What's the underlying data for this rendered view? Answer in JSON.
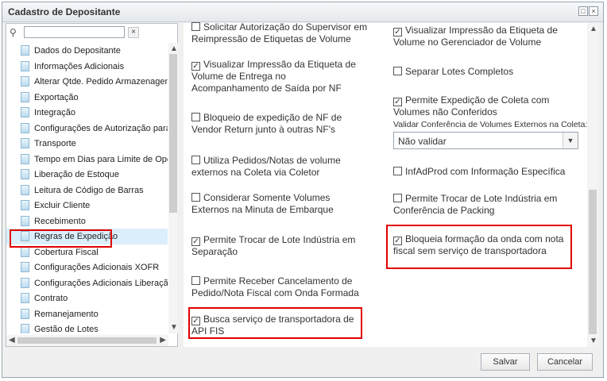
{
  "window": {
    "title": "Cadastro de Depositante",
    "controls": [
      "□",
      "×"
    ]
  },
  "filter": {
    "value": "",
    "clear_label": "×"
  },
  "tree": {
    "items": [
      "Dados do Depositante",
      "Informações Adicionais",
      "Alterar Qtde. Pedido Armazenagem",
      "Exportação",
      "Integração",
      "Configurações de Autorização para B",
      "Transporte",
      "Tempo em Dias para Limite de Operaç",
      "Liberação de Estoque",
      "Leitura de Código de Barras",
      "Excluir Cliente",
      "Recebimento",
      "Regras de Expedição",
      "Cobertura Fiscal",
      "Configurações Adicionais XOFR",
      "Configurações Adicionais Liberação N",
      "Contrato",
      "Remanejamento",
      "Gestão de Lotes"
    ],
    "selected": "Regras de Expedição"
  },
  "options_left": [
    {
      "label_lines": [
        "Solicitar Autorização do Supervisor em",
        "Reimpressão de Etiquetas de Volume"
      ],
      "checked": false
    },
    {
      "label_lines": [
        "Visualizar Impressão da Etiqueta de",
        "Volume de Entrega no",
        "Acompanhamento de Saída por NF"
      ],
      "checked": true
    },
    {
      "label_lines": [
        "Bloqueio de expedição de NF de",
        "Vendor Return junto à outras NF's"
      ],
      "checked": false
    },
    {
      "label_lines": [
        "Utiliza Pedidos/Notas de volume",
        "externos na Coleta via Coletor"
      ],
      "checked": false
    },
    {
      "label_lines": [
        "Considerar Somente Volumes",
        "Externos na Minuta de Embarque"
      ],
      "checked": false
    },
    {
      "label_lines": [
        "Permite Trocar de Lote Indústria em",
        "Separação"
      ],
      "checked": true
    },
    {
      "label_lines": [
        "Permite Receber Cancelamento de",
        "Pedido/Nota Fiscal com Onda Formada"
      ],
      "checked": false
    },
    {
      "label_lines": [
        "Busca serviço de transportadora de",
        "API FIS"
      ],
      "checked": true
    }
  ],
  "options_right": [
    {
      "label_lines": [
        "Visualizar Impressão da Etiqueta de",
        "Volume no Gerenciador de Volume"
      ],
      "checked": true
    },
    {
      "label_lines": [
        "Separar Lotes Completos"
      ],
      "checked": false
    },
    {
      "label_lines": [
        "Permite Expedição de Coleta com",
        "Volumes não Conferidos"
      ],
      "checked": true
    },
    {
      "label_lines": [
        "InfAdProd com Informação Específica"
      ],
      "checked": false
    },
    {
      "label_lines": [
        "Permite Trocar de Lote Indústria em",
        "Conferência de Packing"
      ],
      "checked": false
    },
    {
      "label_lines": [
        "Bloqueia formação da onda com nota",
        "fiscal sem serviço de transportadora"
      ],
      "checked": true
    }
  ],
  "validation": {
    "label": "Validar Conferência de Volumes Externos na Coleta:",
    "selected": "Não validar"
  },
  "buttons": {
    "save": "Salvar",
    "cancel": "Cancelar"
  },
  "colors": {
    "highlight": "#e00000",
    "selected_row": "#dbeefb"
  }
}
